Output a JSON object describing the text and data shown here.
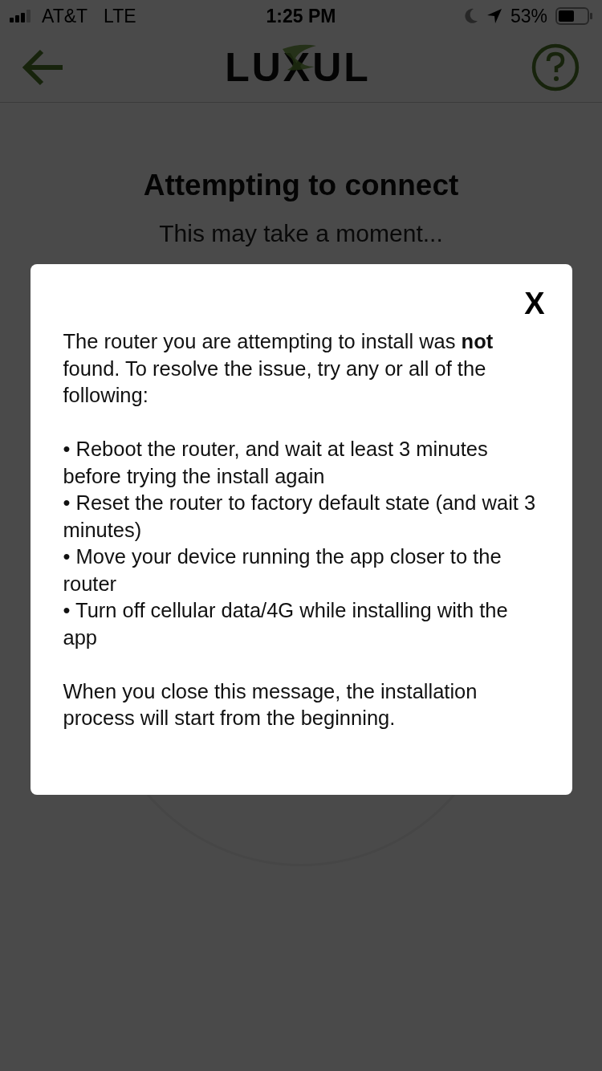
{
  "status_bar": {
    "carrier": "AT&T",
    "network": "LTE",
    "time": "1:25 PM",
    "battery": "53%"
  },
  "header": {
    "logo": "LUXUL"
  },
  "page": {
    "title": "Attempting to connect",
    "subtitle": "This may take a moment..."
  },
  "dialog": {
    "close": "X",
    "paragraphs": [
      "The router you are attempting to install was **not** found. To resolve the issue, try any or all of the following:"
    ],
    "bullets": [
      "• Reboot the router, and wait at least 3 minutes before trying the install again",
      "• Reset the router to factory default state (and wait 3 minutes)",
      "• Move your device running the app closer to the router",
      "• Turn off cellular data/4G while installing with the app"
    ],
    "footer": "When you close this message, the installation process will start from the beginning."
  }
}
